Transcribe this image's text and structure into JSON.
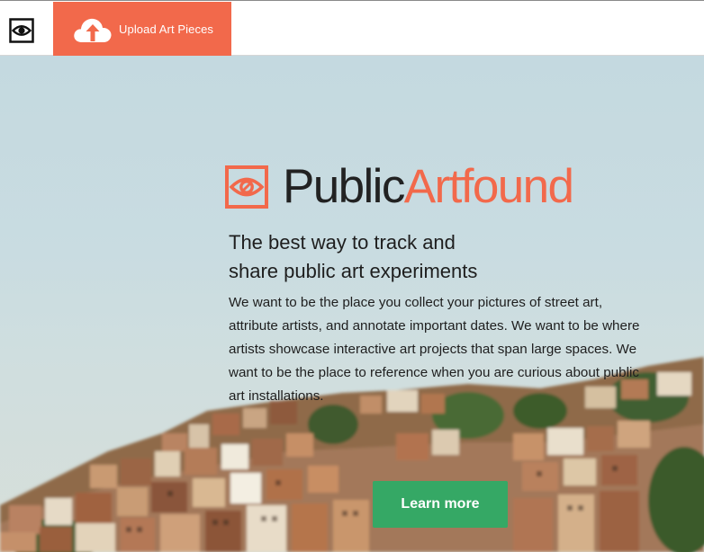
{
  "topbar": {
    "eye_icon": "eye-icon",
    "upload_label": "Upload Art Pieces",
    "upload_icon": "cloud-upload-icon",
    "accent": "#f2694b"
  },
  "hero": {
    "logo_icon": "eye-logo-icon",
    "brand_part1": "Public",
    "brand_part2": "Artfound",
    "tagline_line1": "The best way to track and",
    "tagline_line2": "share public art experiments",
    "blurb": "We want to be the place you collect your pictures of street art, attribute artists, and annotate important dates. We want to be where artists showcase interactive art projects that span large spaces. We want to be the place to reference when you are curious about public art installations.",
    "cta_label": "Learn more",
    "cta_color": "#35a865"
  }
}
